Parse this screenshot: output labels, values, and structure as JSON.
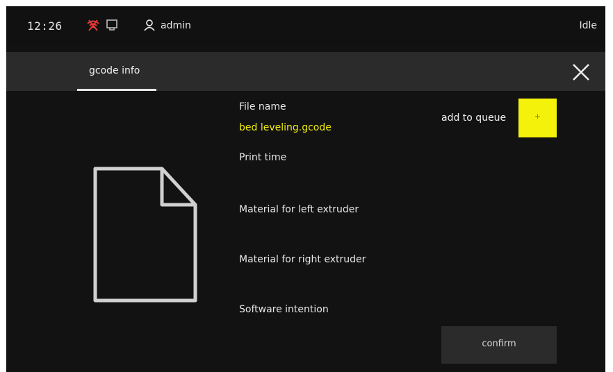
{
  "statusbar": {
    "time": "12:26",
    "wifi_icon": "wifi-disconnected-icon",
    "ethernet_icon": "ethernet-icon",
    "user_icon": "user-icon",
    "username": "admin",
    "status": "Idle"
  },
  "tabs": [
    {
      "label": "gcode info",
      "active": true
    }
  ],
  "close_icon": "close-icon",
  "file_info": {
    "file_name_label": "File name",
    "file_name_value": "bed leveling.gcode",
    "print_time_label": "Print time",
    "material_left_label": "Material for left extruder",
    "material_right_label": "Material for right extruder",
    "software_intention_label": "Software intention"
  },
  "queue": {
    "label": "add to queue",
    "button_text": "+"
  },
  "confirm_label": "confirm",
  "colors": {
    "accent": "#f4f20a",
    "highlight_text": "#f2ee0c",
    "background": "#121212",
    "panel": "#2b2b2b",
    "wifi_error": "#e53935"
  }
}
